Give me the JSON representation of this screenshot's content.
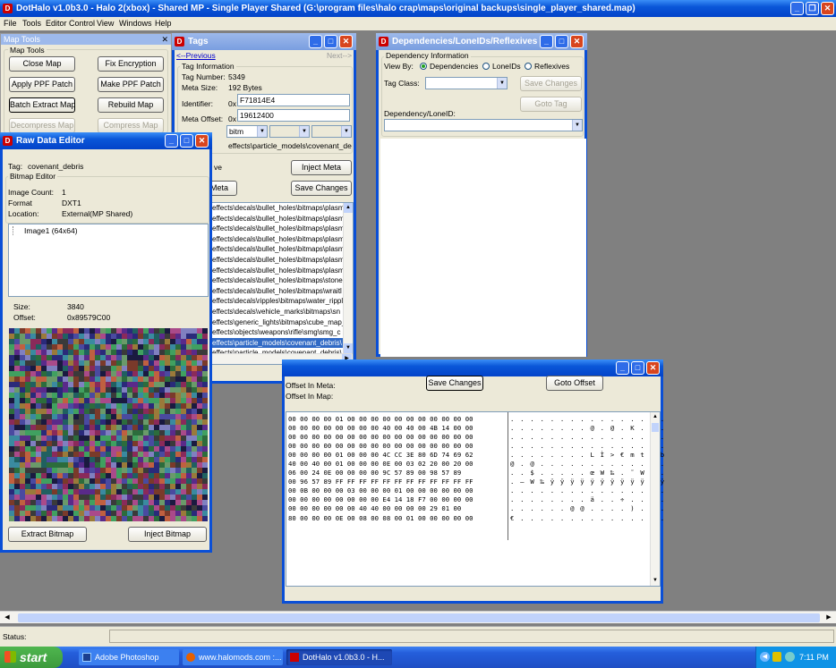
{
  "app": {
    "title": "DotHalo v1.0b3.0 - Halo 2(xbox) - Shared MP - Single Player Shared (G:\\program files\\halo crap\\maps\\original backups\\single_player_shared.map)"
  },
  "menu": [
    "File",
    "Tools",
    "Editor Control",
    "View",
    "Windows",
    "Help"
  ],
  "map_tools": {
    "title": "Map Tools",
    "group": "Map Tools",
    "buttons": [
      "Close Map",
      "Fix Encryption",
      "Apply PPF Patch",
      "Make PPF Patch",
      "Batch Extract Map",
      "Rebuild Map",
      "Decompress Map",
      "Compress Map"
    ]
  },
  "tags": {
    "title": "Tags",
    "nav_prev": "<--Previous",
    "nav_next": "Next-->",
    "group": "Tag Information",
    "tag_number_label": "Tag Number:",
    "tag_number": "5349",
    "meta_size_label": "Meta Size:",
    "meta_size": "192 Bytes",
    "identifier_label": "Identifier:",
    "identifier_prefix": "0x",
    "identifier": "F71814E4",
    "meta_offset_label": "Meta Offset:",
    "meta_offset_prefix": "0x",
    "meta_offset": "19612400",
    "class": "bitm",
    "path": "effects\\particle_models\\covenant_deb",
    "save_label": "ve",
    "inject_meta": "Inject Meta",
    "extract_meta": "Meta",
    "save_changes": "Save Changes",
    "items": [
      "effects\\decals\\bullet_holes\\bitmaps\\plasm",
      "effects\\decals\\bullet_holes\\bitmaps\\plasm",
      "effects\\decals\\bullet_holes\\bitmaps\\plasm",
      "effects\\decals\\bullet_holes\\bitmaps\\plasm",
      "effects\\decals\\bullet_holes\\bitmaps\\plasm",
      "effects\\decals\\bullet_holes\\bitmaps\\plasm",
      "effects\\decals\\bullet_holes\\bitmaps\\plasm",
      "effects\\decals\\bullet_holes\\bitmaps\\stone",
      "effects\\decals\\bullet_holes\\bitmaps\\wraitl",
      "effects\\decals\\ripples\\bitmaps\\water_rippl",
      "effects\\decals\\vehicle_marks\\bitmaps\\sn",
      "effects\\generic_lights\\bitmaps\\cube_map_",
      "effects\\objects\\weapons\\rifle\\smg\\smg_c",
      "effects\\particle_models\\covenant_debris\\",
      "effects\\particle_models\\covenant_debris\\"
    ],
    "selected_index": 13
  },
  "deps": {
    "title": "Dependencies/LoneIDs/Reflexives",
    "group": "Dependency Information",
    "view_by": "View By:",
    "options": [
      "Dependencies",
      "LoneIDs",
      "Reflexives"
    ],
    "tag_class_label": "Tag Class:",
    "save_changes": "Save Changes",
    "goto_tag": "Goto Tag",
    "dep_label": "Dependency/LoneID:"
  },
  "raw": {
    "title": "Raw Data Editor",
    "tag_label": "Tag:",
    "tag": "covenant_debris",
    "group": "Bitmap Editor",
    "image_count_label": "Image Count:",
    "image_count": "1",
    "format_label": "Format",
    "format": "DXT1",
    "location_label": "Location:",
    "location": "External(MP Shared)",
    "tree_item": "Image1 (64x64)",
    "size_label": "Size:",
    "size": "3840",
    "offset_label": "Offset:",
    "offset": "0x89579C00",
    "extract": "Extract Bitmap",
    "inject": "Inject Bitmap"
  },
  "hex": {
    "offset_in_meta": "Offset In Meta:",
    "offset_in_map": "Offset In Map:",
    "save_changes": "Save Changes",
    "goto_offset": "Goto Offset",
    "hex_lines": [
      "00 00 00 00 01 00 00 00 00 00 00 00 00 00 00 00",
      "00 00 00 00 00 00 00 00 40 00 40 00 4B 14 00 00",
      "00 00 00 00 00 00 00 00 00 00 00 00 00 00 00 00",
      "00 00 00 00 00 00 00 00 00 00 00 00 00 00 00 00",
      "00 00 00 00 01 00 00 00 4C CC 3E 80 6D 74 69 62",
      "40 00 40 00 01 00 00 00 0E 00 03 02 20 00 20 00",
      "06 00 24 0E 00 00 00 00 9C 57 89 00 98 57 89",
      "00 96 57 89 FF FF FF FF FF FF FF FF FF FF FF FF",
      "00 0B 00 00 00 03 00 00 00 01 00 00 00 00 00 00",
      "00 00 00 00 00 00 00 00 E4 14 18 F7 00 00 00 00",
      "00 00 00 00 00 00 40 40 00 00 00 00 29 01 00",
      "80 00 00 00 0E 00 08 00 08 00 01 00 00 00 00 00"
    ],
    "ascii_lines": [
      ". . . . . . . . . . . . . . . .",
      ". . . . . . . . @ . @ . K . . .",
      ". . . . . . . . . . . . . . . .",
      ". . . . . . . . . . . . . . . .",
      ". . . . . . . . L Ì > € m t i b",
      "@ . @ . . . . . . . . . . . . .",
      ". . $ . . . . . œ W ‰ . ˜ W ‰ .",
      ". – W ‰ ÿ ÿ ÿ ÿ ÿ ÿ ÿ ÿ ÿ ÿ ÿ ÿ",
      ". . . . . . . . . . . . . . . .",
      ". . . . . . . . ä . . ÷ . . . .",
      ". . . . . . @ @ . . . . ) . . .",
      "€ . . . . . . . . . . . . . . ."
    ]
  },
  "status": {
    "label": "Status:"
  },
  "taskbar": {
    "start": "start",
    "items": [
      "Adobe Photoshop",
      "www.halomods.com :...",
      "DotHalo v1.0b3.0 - H..."
    ],
    "time": "7:11 PM"
  },
  "colors": {
    "accent": "#0a56d8",
    "desktop": "#808080",
    "selection": "#316ac5",
    "taskbar": "#245edb",
    "start": "#3c9a3c"
  }
}
